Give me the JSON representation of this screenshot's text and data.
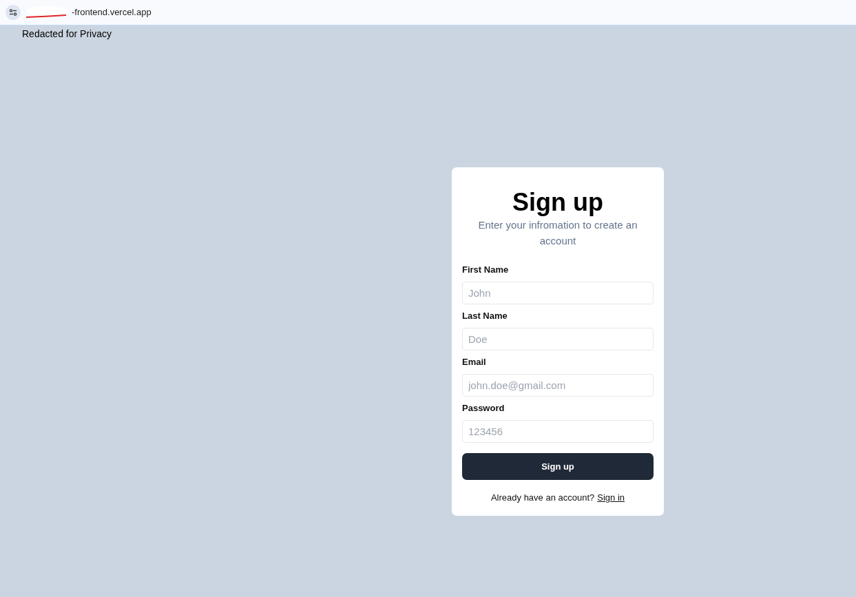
{
  "address_bar": {
    "url": "-frontend.vercel.app"
  },
  "page_note": "Redacted for Privacy",
  "card": {
    "title": "Sign up",
    "subtitle": "Enter your infromation to create an account",
    "fields": [
      {
        "label": "First Name",
        "placeholder": "John"
      },
      {
        "label": "Last Name",
        "placeholder": "Doe"
      },
      {
        "label": "Email",
        "placeholder": "john.doe@gmail.com"
      },
      {
        "label": "Password",
        "placeholder": "123456"
      }
    ],
    "submit": "Sign up",
    "footer": {
      "text": "Already have an account?",
      "link": "Sign in"
    }
  }
}
